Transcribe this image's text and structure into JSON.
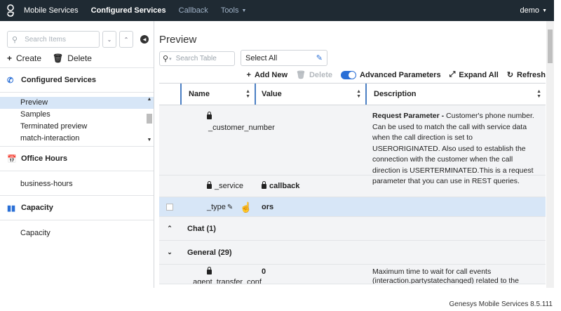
{
  "topbar": {
    "app_name": "Mobile Services",
    "nav": [
      "Configured Services",
      "Callback",
      "Tools"
    ],
    "user": "demo"
  },
  "sidebar": {
    "search_placeholder": "Search Items",
    "create_label": "Create",
    "delete_label": "Delete",
    "sections": [
      {
        "title": "Configured Services",
        "items": [
          "Preview",
          "Samples",
          "Terminated preview",
          "match-interaction"
        ],
        "selected": 0
      },
      {
        "title": "Office Hours",
        "items": [
          "business-hours"
        ]
      },
      {
        "title": "Capacity",
        "items": [
          "Capacity"
        ]
      }
    ]
  },
  "main": {
    "title": "Preview",
    "search_placeholder": "Search Table",
    "select_label": "Select All",
    "toolbar": {
      "add_new": "Add New",
      "delete": "Delete",
      "advanced": "Advanced Parameters",
      "expand": "Expand All",
      "refresh": "Refresh"
    },
    "columns": [
      "Name",
      "Value",
      "Description"
    ],
    "rows": [
      {
        "name": "_customer_number",
        "value": "",
        "desc_bold": "Request Parameter -",
        "desc": " Customer's phone number. Can be used to match the call with service data when the call direction is set to USERORIGINATED. Also used to establish the connection with the customer when the call direction is USERTERMINATED.This is a request parameter that you can use in REST queries."
      },
      {
        "name": "_service",
        "value": "callback",
        "desc": ""
      },
      {
        "name": "_type",
        "value": "ors",
        "desc": ""
      }
    ],
    "groups": [
      {
        "label": "Chat (1)"
      },
      {
        "label": "General (29)"
      }
    ],
    "last_row": {
      "name": "_agent_transfer_conf",
      "value": "0",
      "desc": "Maximum time to wait for call events (interaction.partystatechanged) related to the transfer of the"
    }
  },
  "footer": "Genesys Mobile Services 8.5.111"
}
